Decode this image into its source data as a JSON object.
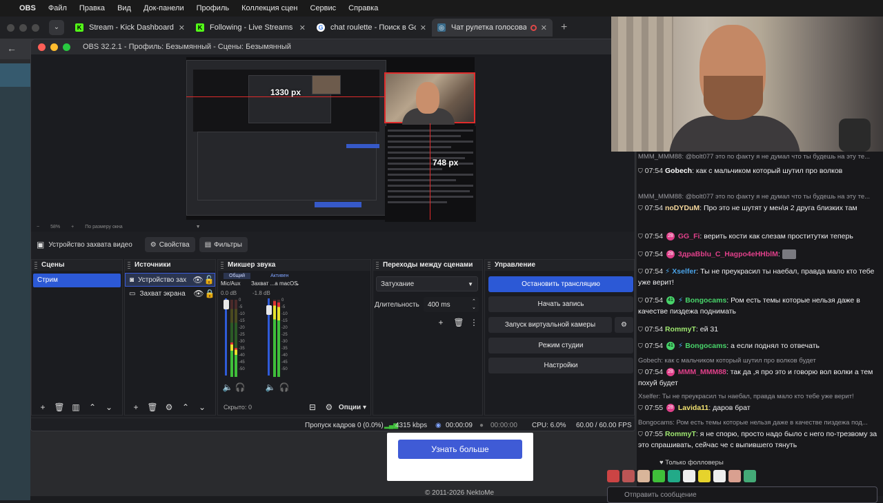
{
  "menubar": {
    "app": "OBS",
    "items": [
      "Файл",
      "Правка",
      "Вид",
      "Док-панели",
      "Профиль",
      "Коллекция сцен",
      "Сервис",
      "Справка"
    ]
  },
  "browser": {
    "tabs": [
      {
        "title": "Stream - Kick Dashboard",
        "favicon": "kick-icon"
      },
      {
        "title": "Following - Live Streams on Kick",
        "favicon": "kick-icon"
      },
      {
        "title": "chat roulette - Поиск в Google",
        "favicon": "google-icon"
      },
      {
        "title": "Чат рулетка голосовая",
        "favicon": "camera-icon",
        "active": true
      }
    ],
    "page": {
      "learn_more": "Узнать больше",
      "copyright": "© 2011-2026 NektoMe"
    }
  },
  "obs": {
    "title": "OBS 32.2.1 - Профиль: Безымянный - Сцены: Безымянный",
    "preview": {
      "width_label": "1330 px",
      "height_label": "748 px",
      "zoom": "58%",
      "fit": "По размеру окна"
    },
    "source_toolbar": {
      "source": "Устройство захвата видео",
      "properties": "Свойства",
      "filters": "Фильтры"
    },
    "scenes": {
      "title": "Сцены",
      "items": [
        "Стрим"
      ]
    },
    "sources": {
      "title": "Источники",
      "items": [
        "Устройство зах",
        "Захват экрана"
      ]
    },
    "mixer": {
      "title": "Микшер звука",
      "tab_all": "Общий",
      "tab_active": "Активен",
      "channels": [
        {
          "name": "Mic/Aux",
          "db": "0.0 dB"
        },
        {
          "name": "Захват ...а macOS",
          "db": "-1.8 dB"
        }
      ],
      "ticks": [
        "0",
        "-5",
        "-10",
        "-15",
        "-20",
        "-25",
        "-30",
        "-35",
        "-40",
        "-45",
        "-50",
        "-55",
        "-60"
      ],
      "hidden": "Скрыто: 0",
      "options": "Опции"
    },
    "transitions": {
      "title": "Переходы между сценами",
      "type": "Затухание",
      "duration_label": "Длительность",
      "duration": "400 ms"
    },
    "controls": {
      "title": "Управление",
      "stop_stream": "Остановить трансляцию",
      "start_record": "Начать запись",
      "virtual_cam": "Запуск виртуальной камеры",
      "studio_mode": "Режим студии",
      "settings": "Настройки"
    },
    "status": {
      "dropped": "Пропуск кадров 0 (0.0%)",
      "bitrate": "4315 kbps",
      "stream_time": "00:00:09",
      "record_time": "00:00:00",
      "cpu": "CPU: 6.0%",
      "fps": "60.00 / 60.00 FPS"
    }
  },
  "chat": {
    "messages": [
      {
        "reply": "MMM_MMM88: @bolt077 это по факту я не думал что ты будешь на эту те...",
        "time": "07:54",
        "user": "Gobech",
        "user_color": "#ffffff",
        "text": "как с мальчиком который шутил про волков"
      },
      {
        "reply": "MMM_MMM88: @bolt077 это по факту я не думал что ты будешь на эту те...",
        "time": "07:54",
        "user": "noDYDuM",
        "user_color": "#f5d79c",
        "text": "Про это не шутят у мен\\я 2 друга близких там"
      },
      {
        "time": "07:54",
        "badge": "28",
        "user": "GG_Fi",
        "user_color": "#e0408a",
        "text": "верить кости как слезам проститутки теперь"
      },
      {
        "time": "07:54",
        "badge": "28",
        "user": "3дpaBblu_C_Hagpo4eHHblM",
        "user_color": "#e0408a",
        "text": ""
      },
      {
        "time": "07:54",
        "user": "Xselfer",
        "user_color": "#4aa3e8",
        "text": "Ты не преукрасил ты наебал, правда мало кто тебе уже верит!"
      },
      {
        "time": "07:54",
        "badge": "41",
        "user": "Bongocams",
        "user_color": "#48d46a",
        "text": "Ром есть темы которые нельзя даже в качестве пиздежа поднимать"
      },
      {
        "time": "07:54",
        "user": "RommyT",
        "user_color": "#9fe870",
        "text": "ей 31"
      },
      {
        "time": "07:54",
        "badge": "41",
        "user": "Bongocams",
        "user_color": "#48d46a",
        "text": "а если поднял то отвечать"
      },
      {
        "reply": "Gobech: как с мальчиком который шутил про волков будет",
        "time": "07:54",
        "badge": "28",
        "user": "MMM_MMM88",
        "user_color": "#e0408a",
        "text": "так да ,я про это и говорю вол волки а тем похуй будет"
      },
      {
        "reply": "Xselfer: Ты не преукрасил ты наебал, правда мало кто тебе уже верит!",
        "time": "07:55",
        "badge": "28",
        "user": "Lavida11",
        "user_color": "#f0e070",
        "text": "даров брат"
      },
      {
        "reply": "Bongocams: Ром есть темы которые нельзя даже в качестве пиздежа под...",
        "time": "07:55",
        "user": "RommyT",
        "user_color": "#9fe870",
        "text": "я не спорю, просто надо было с него по-трезвому за это спрашивать, сейчас че с выпившего тянуть"
      }
    ],
    "followers_only": "Только фолловеры",
    "input_placeholder": "Отправить сообщение"
  },
  "colors": {
    "accent": "#2c59d6",
    "recording_red": "#e02b2b",
    "kick_green": "#53fc18"
  }
}
